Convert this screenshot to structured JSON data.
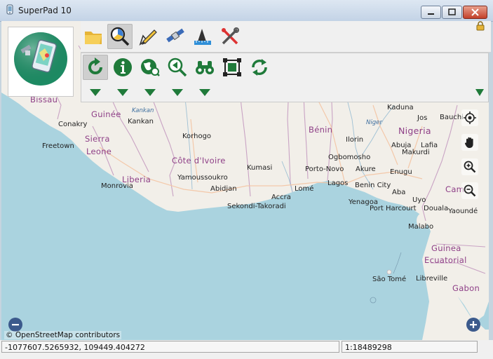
{
  "window": {
    "title": "SuperPad 10"
  },
  "toolbar": {
    "row1": [
      {
        "name": "open-folder-icon",
        "active": false
      },
      {
        "name": "magnifier-chart-icon",
        "active": true
      },
      {
        "name": "pencil-draw-icon",
        "active": false
      },
      {
        "name": "satellite-icon",
        "active": false
      },
      {
        "name": "ruler-measure-icon",
        "active": false
      },
      {
        "name": "tools-settings-icon",
        "active": false
      }
    ],
    "row2": [
      {
        "name": "refresh-icon",
        "active": true
      },
      {
        "name": "info-icon",
        "active": false
      },
      {
        "name": "globe-search-icon",
        "active": false
      },
      {
        "name": "zoom-back-icon",
        "active": false
      },
      {
        "name": "binoculars-icon",
        "active": false
      },
      {
        "name": "select-frame-icon",
        "active": false
      },
      {
        "name": "sync-icon",
        "active": false
      }
    ]
  },
  "map": {
    "countries": [
      {
        "id": "guinee",
        "text": "Guinée"
      },
      {
        "id": "sierra",
        "text": "Sierra"
      },
      {
        "id": "leone",
        "text": "Leone"
      },
      {
        "id": "liberia",
        "text": "Liberia"
      },
      {
        "id": "cotedivoire",
        "text": "Côte d'Ivoire"
      },
      {
        "id": "benin",
        "text": "Bénin"
      },
      {
        "id": "nigeria",
        "text": "Nigeria"
      },
      {
        "id": "guinea",
        "text": "Guinea"
      },
      {
        "id": "ecuatorial",
        "text": "Ecuatorial"
      },
      {
        "id": "gabon",
        "text": "Gabon"
      },
      {
        "id": "cam",
        "text": "Cam"
      },
      {
        "id": "bissau",
        "text": "Bissau"
      }
    ],
    "rivers": [
      {
        "id": "kankan-river",
        "text": "Kankan"
      },
      {
        "id": "niger",
        "text": "Niger"
      }
    ],
    "cities": [
      {
        "id": "conakry",
        "text": "Conakry"
      },
      {
        "id": "kankan",
        "text": "Kankan"
      },
      {
        "id": "freetown",
        "text": "Freetown"
      },
      {
        "id": "monrovia",
        "text": "Monrovia"
      },
      {
        "id": "korhogo",
        "text": "Korhogo"
      },
      {
        "id": "yamoussoukro",
        "text": "Yamoussoukro"
      },
      {
        "id": "abidjan",
        "text": "Abidjan"
      },
      {
        "id": "kumasi",
        "text": "Kumasi"
      },
      {
        "id": "accra",
        "text": "Accra"
      },
      {
        "id": "sekondi",
        "text": "Sekondi-Takoradi"
      },
      {
        "id": "lome",
        "text": "Lomé"
      },
      {
        "id": "portonovo",
        "text": "Porto-Novo"
      },
      {
        "id": "lagos",
        "text": "Lagos"
      },
      {
        "id": "ogbomosho",
        "text": "Ogbomosho"
      },
      {
        "id": "ilorin",
        "text": "Ilorin"
      },
      {
        "id": "akure",
        "text": "Akure"
      },
      {
        "id": "benincity",
        "text": "Benin City"
      },
      {
        "id": "kaduna",
        "text": "Kaduna"
      },
      {
        "id": "jos",
        "text": "Jos"
      },
      {
        "id": "bauchi",
        "text": "Bauchi"
      },
      {
        "id": "abuja",
        "text": "Abuja"
      },
      {
        "id": "lafia",
        "text": "Lafia"
      },
      {
        "id": "makurdi",
        "text": "Makurdi"
      },
      {
        "id": "enugu",
        "text": "Enugu"
      },
      {
        "id": "aba",
        "text": "Aba"
      },
      {
        "id": "uyo",
        "text": "Uyo"
      },
      {
        "id": "yenagoa",
        "text": "Yenagoa"
      },
      {
        "id": "portharcourt",
        "text": "Port Harcourt"
      },
      {
        "id": "douala",
        "text": "Douala"
      },
      {
        "id": "yaounde",
        "text": "Yaoundé"
      },
      {
        "id": "malabo",
        "text": "Malabo"
      },
      {
        "id": "saotome",
        "text": "São Tomé"
      },
      {
        "id": "libreville",
        "text": "Libreville"
      }
    ],
    "attribution": "© OpenStreetMap contributors"
  },
  "status": {
    "coordinates": "-1077607.5265932, 109449.404272",
    "scale": "1:18489298"
  },
  "colors": {
    "water": "#aad3df",
    "land": "#f2efe9",
    "border": "#c9a3c4",
    "toolbar": "#f0f0f0",
    "accent_green": "#1f7a3a"
  }
}
